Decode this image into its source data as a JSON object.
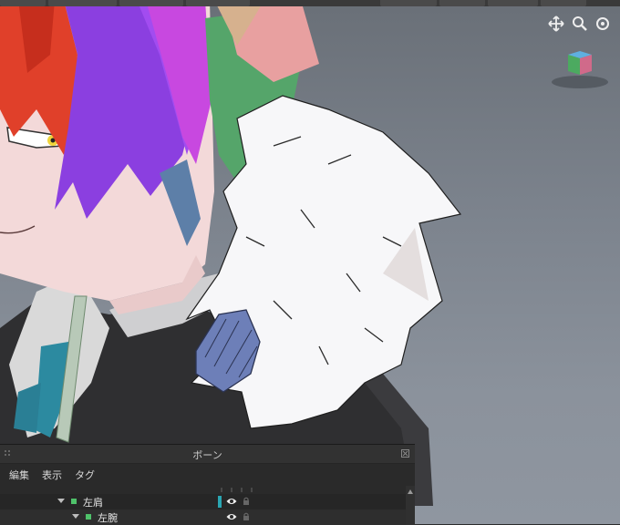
{
  "toolbar": {
    "tabs": [
      "",
      "",
      "",
      "",
      "",
      "",
      "",
      ""
    ]
  },
  "panel": {
    "title": "ボーン",
    "menu": [
      "編集",
      "表示",
      "タグ"
    ],
    "bones": [
      {
        "label": "左肩",
        "depth": 0,
        "selected": true
      },
      {
        "label": "左腕",
        "depth": 1,
        "selected": false
      }
    ]
  },
  "viewport": {
    "icons": [
      "move-icon",
      "zoom-icon",
      "rotate-icon",
      "view-cube-icon"
    ],
    "accent": "#2aa6b2",
    "bone_color": "#4fc26a"
  }
}
